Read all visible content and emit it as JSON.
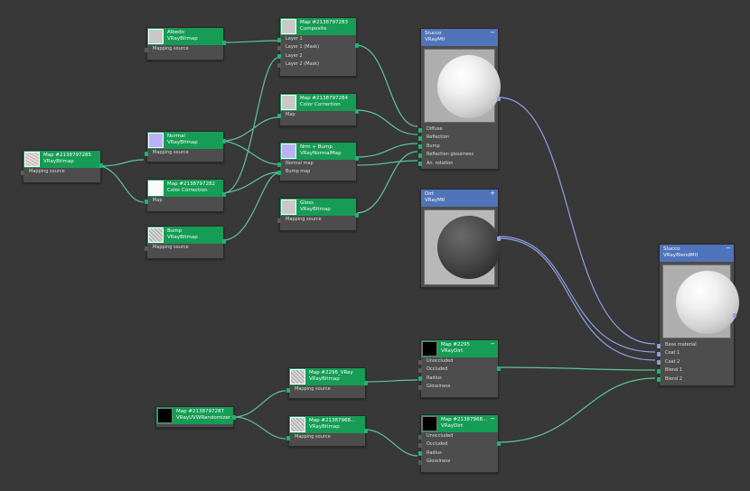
{
  "nodes": {
    "n285": {
      "title": "Map #2138797285",
      "subtitle": "VRayBitmap",
      "inputs": [
        "Mapping source"
      ]
    },
    "albedo": {
      "title": "Albedo",
      "subtitle": "VRayBitmap",
      "inputs": [
        "Mapping source"
      ]
    },
    "normal": {
      "title": "Normal",
      "subtitle": "VRayBitmap",
      "inputs": [
        "Mapping source"
      ]
    },
    "n282": {
      "title": "Map #2138797282",
      "subtitle": "Color Correction",
      "inputs": [
        "Map"
      ]
    },
    "bump": {
      "title": "Bump",
      "subtitle": "VRayBitmap",
      "inputs": [
        "Mapping source"
      ]
    },
    "n283": {
      "title": "Map #2138797283",
      "subtitle": "Composite",
      "inputs": [
        "Layer 1",
        "Layer 1 (Mask)",
        "Layer 2",
        "Layer 2 (Mask)"
      ]
    },
    "n284": {
      "title": "Map #2138797284",
      "subtitle": "Color Correction",
      "inputs": [
        "Map"
      ]
    },
    "nrmbump": {
      "title": "Nrm + Bump",
      "subtitle": "VRayNormalMap",
      "inputs": [
        "Normal map",
        "Bump map"
      ]
    },
    "gloss": {
      "title": "Gloss",
      "subtitle": "VRayBitmap",
      "inputs": [
        "Mapping source"
      ]
    },
    "stucco": {
      "title": "Stucco",
      "subtitle": "VRayMtl",
      "inputs": [
        "Diffuse",
        "Reflection",
        "Bump",
        "Reflection glossiness",
        "An. rotation"
      ]
    },
    "dirt": {
      "title": "Dirt",
      "subtitle": "VRayMtl",
      "inputs": []
    },
    "stucco2": {
      "title": "Stucco",
      "subtitle": "VRayBlendMtl",
      "inputs": [
        "Base material",
        "Coat 1",
        "Coat 2",
        "Blend 1",
        "Blend 2"
      ]
    },
    "n287": {
      "title": "Map #2138797287",
      "subtitle": "VRayUVWRandomizer",
      "inputs": []
    },
    "n2296": {
      "title": "Map #2296_VRay",
      "subtitle": "VRayBitmap",
      "inputs": [
        "Mapping source"
      ]
    },
    "n968a": {
      "title": "Map #21387968...",
      "subtitle": "VRayBitmap",
      "inputs": [
        "Mapping source"
      ]
    },
    "n2295": {
      "title": "Map #2295",
      "subtitle": "VRayDirt",
      "inputs": [
        "Unoccluded",
        "Occluded",
        "Radius",
        "Glossiness"
      ]
    },
    "n968b": {
      "title": "Map #21387968...",
      "subtitle": "VRayDirt",
      "inputs": [
        "Unoccluded",
        "Occluded",
        "Radius",
        "Glossiness"
      ]
    }
  },
  "icons": {
    "collapse": "−",
    "expand": "+"
  },
  "colors": {
    "background": "#383838",
    "node_green": "#169c55",
    "node_blue": "#4f74ba",
    "wire_green": "#5fc39a",
    "wire_blue": "#8d9fe3"
  }
}
